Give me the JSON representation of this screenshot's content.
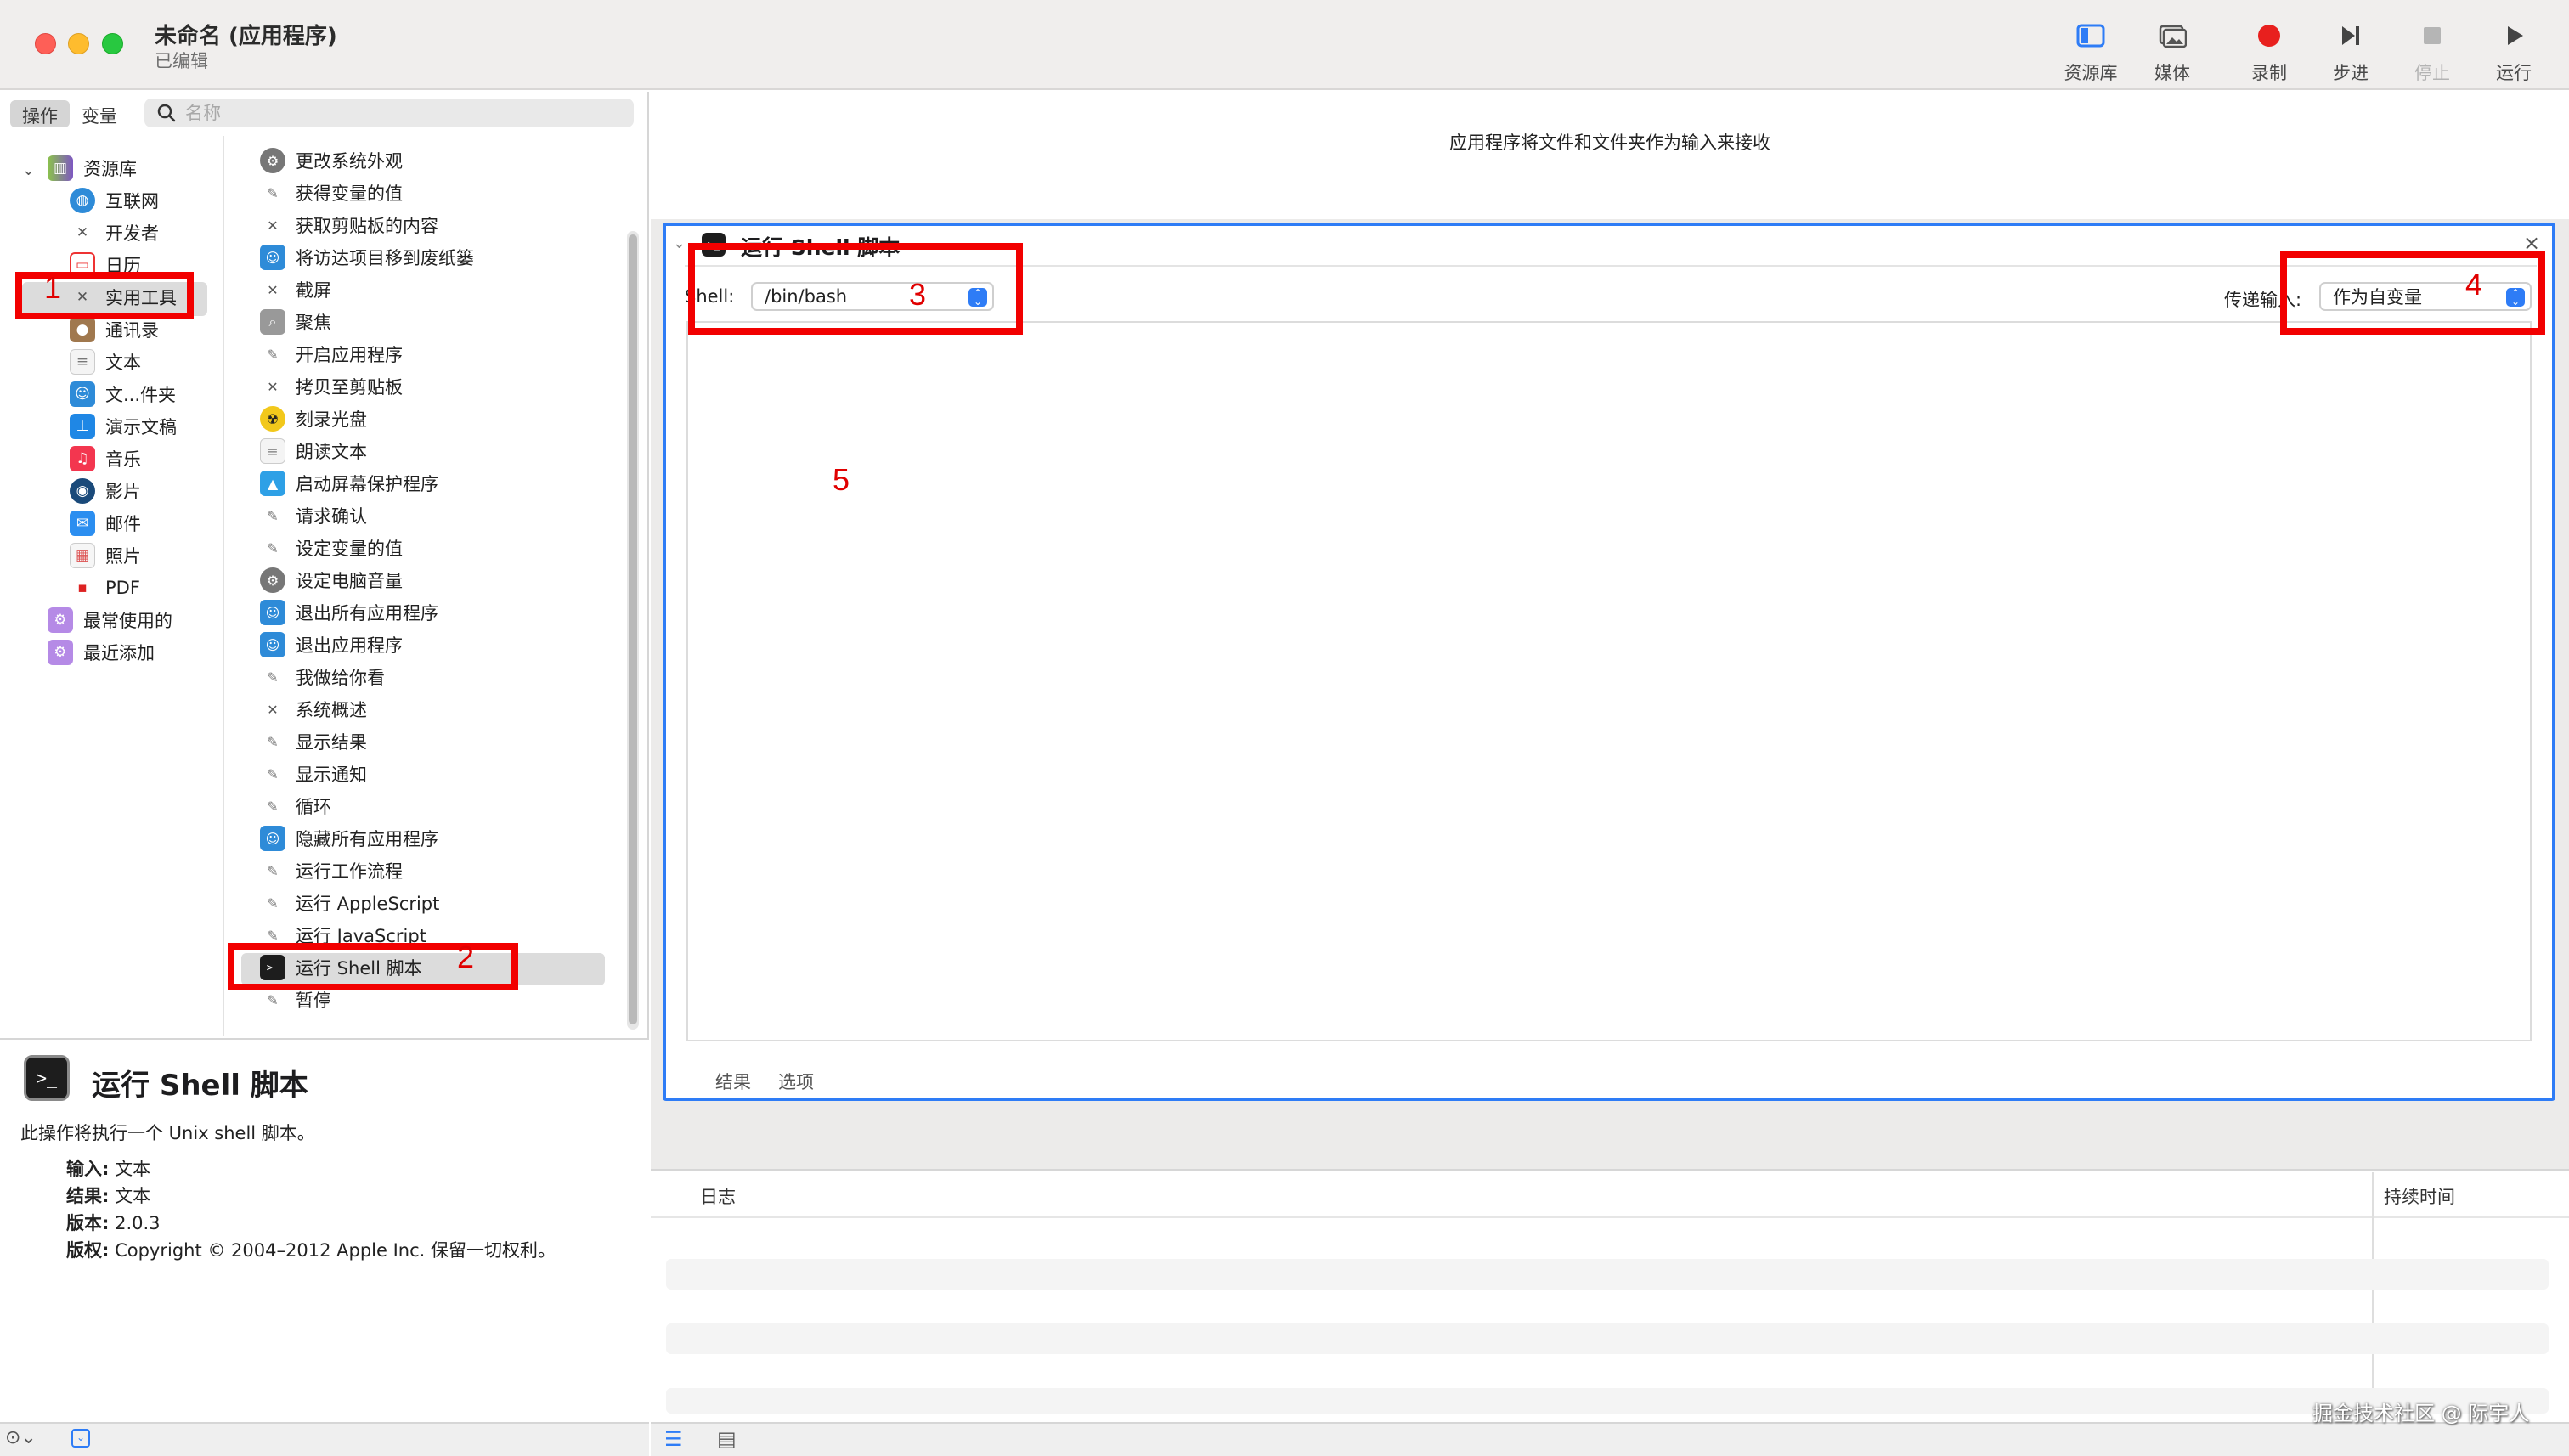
{
  "window": {
    "title": "未命名 (应用程序)",
    "subtitle": "已编辑"
  },
  "toolbar": {
    "items": [
      {
        "label": "资源库",
        "icon": "sidebar-icon"
      },
      {
        "label": "媒体",
        "icon": "photo-icon"
      },
      {
        "label": "录制",
        "icon": "record-icon"
      },
      {
        "label": "步进",
        "icon": "step-icon"
      },
      {
        "label": "停止",
        "icon": "stop-icon"
      },
      {
        "label": "运行",
        "icon": "play-icon"
      }
    ]
  },
  "library": {
    "tabs": [
      "操作",
      "变量"
    ],
    "search_placeholder": "名称",
    "categories": [
      "资源库",
      "互联网",
      "开发者",
      "日历",
      "实用工具",
      "通讯录",
      "文本",
      "文...件夹",
      "演示文稿",
      "音乐",
      "影片",
      "邮件",
      "照片",
      "PDF",
      "最常使用的",
      "最近添加"
    ],
    "actions": [
      "更改系统外观",
      "获得变量的值",
      "获取剪贴板的内容",
      "将访达项目移到废纸篓",
      "截屏",
      "聚焦",
      "开启应用程序",
      "拷贝至剪贴板",
      "刻录光盘",
      "朗读文本",
      "启动屏幕保护程序",
      "请求确认",
      "设定变量的值",
      "设定电脑音量",
      "退出所有应用程序",
      "退出应用程序",
      "我做给你看",
      "系统概述",
      "显示结果",
      "显示通知",
      "循环",
      "隐藏所有应用程序",
      "运行工作流程",
      "运行 AppleScript",
      "运行 JavaScript",
      "运行 Shell 脚本",
      "暂停"
    ]
  },
  "description": {
    "title": "运行 Shell 脚本",
    "text": "此操作将执行一个 Unix shell 脚本。",
    "rows": [
      {
        "key": "输入:",
        "value": "文本"
      },
      {
        "key": "结果:",
        "value": "文本"
      },
      {
        "key": "版本:",
        "value": "2.0.3"
      },
      {
        "key": "版权:",
        "value": "Copyright © 2004–2012 Apple Inc. 保留一切权利。"
      }
    ]
  },
  "workflow": {
    "accepts_text": "应用程序将文件和文件夹作为输入来接收",
    "action": {
      "title": "运行 Shell 脚本",
      "shell_label": "Shell:",
      "shell_value": "/bin/bash",
      "pass_input_label": "传递输入:",
      "pass_input_value": "作为自变量",
      "script": "",
      "tabs": [
        "结果",
        "选项"
      ]
    }
  },
  "log": {
    "col_log": "日志",
    "col_duration": "持续时间"
  },
  "annotations": [
    "1",
    "2",
    "3",
    "4",
    "5"
  ],
  "watermark": "掘金技术社区 @ 际宇人",
  "colors": {
    "accent": "#2e7cf6",
    "annotation_red": "#f20000",
    "record_red": "#e8201e"
  }
}
